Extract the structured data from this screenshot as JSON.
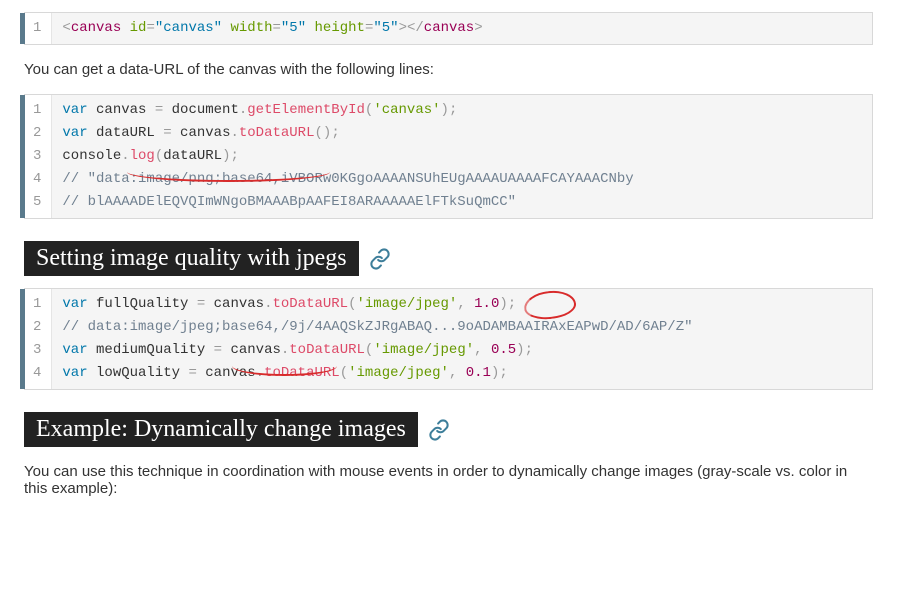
{
  "block1": {
    "lines": [
      "1"
    ],
    "html": "<canvas id=\"canvas\" width=\"5\" height=\"5\"></canvas>"
  },
  "para1": "You can get a data-URL of the canvas with the following lines:",
  "block2": {
    "lines": [
      "1",
      "2",
      "3",
      "4",
      "5"
    ],
    "l1_kw": "var",
    "l1_a": " canvas ",
    "l1_eq": "=",
    "l1_b": " document",
    "l1_dot": ".",
    "l1_fn": "getElementById",
    "l1_p1": "(",
    "l1_str": "'canvas'",
    "l1_p2": ")",
    "l1_end": ";",
    "l2_kw": "var",
    "l2_a": " dataURL ",
    "l2_eq": "=",
    "l2_b": " canvas",
    "l2_dot": ".",
    "l2_fn": "toDataURL",
    "l2_p1": "(",
    "l2_p2": ")",
    "l2_end": ";",
    "l3_a": "console",
    "l3_dot": ".",
    "l3_fn": "log",
    "l3_p1": "(",
    "l3_arg": "dataURL",
    "l3_p2": ")",
    "l3_end": ";",
    "l4": "// \"data:image/png;base64,iVBORw0KGgoAAAANSUhEUgAAAAUAAAAFCAYAAACNby",
    "l5": "// blAAAADElEQVQImWNgoBMAAABpAAFEI8ARAAAAAElFTkSuQmCC\""
  },
  "heading1": "Setting image quality with jpegs",
  "block3": {
    "lines": [
      "1",
      "2",
      "3",
      "4"
    ],
    "l1_kw": "var",
    "l1_a": " fullQuality ",
    "l1_eq": "=",
    "l1_b": " canvas",
    "l1_dot": ".",
    "l1_fn": "toDataURL",
    "l1_p1": "(",
    "l1_str": "'image/jpeg'",
    "l1_comma": ",",
    "l1_sp": " ",
    "l1_num": "1.0",
    "l1_p2": ")",
    "l1_end": ";",
    "l2": "// data:image/jpeg;base64,/9j/4AAQSkZJRgABAQ...9oADAMBAAIRAxEAPwD/AD/6AP/Z\"",
    "l3_kw": "var",
    "l3_a": " mediumQuality ",
    "l3_eq": "=",
    "l3_b": " canvas",
    "l3_dot": ".",
    "l3_fn": "toDataURL",
    "l3_p1": "(",
    "l3_str": "'image/jpeg'",
    "l3_comma": ",",
    "l3_sp": " ",
    "l3_num": "0.5",
    "l3_p2": ")",
    "l3_end": ";",
    "l4_kw": "var",
    "l4_a": " lowQuality ",
    "l4_eq": "=",
    "l4_b": " canvas",
    "l4_dot": ".",
    "l4_fn": "toDataURL",
    "l4_p1": "(",
    "l4_str": "'image/jpeg'",
    "l4_comma": ",",
    "l4_sp": " ",
    "l4_num": "0.1",
    "l4_p2": ")",
    "l4_end": ";"
  },
  "heading2": "Example: Dynamically change images",
  "para2": "You can use this technique in coordination with mouse events in order to dynamically change images (gray-scale vs. color in this example):"
}
